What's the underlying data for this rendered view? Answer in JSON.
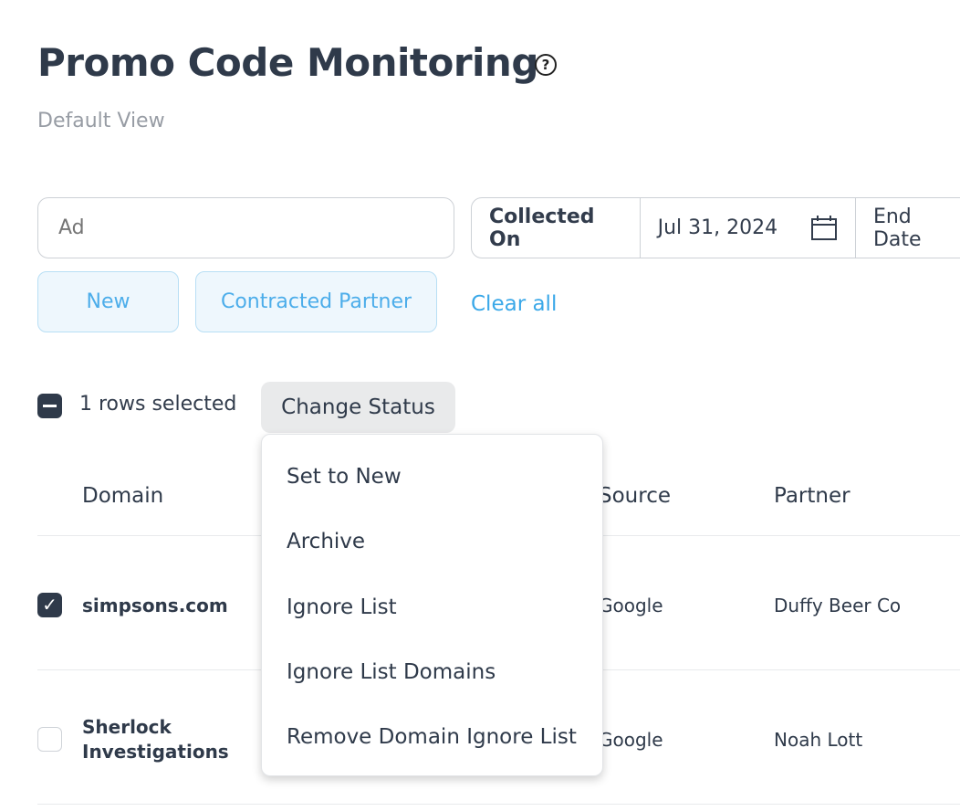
{
  "header": {
    "title": "Promo Code Monitoring",
    "help_icon": "?",
    "subtitle": "Default View"
  },
  "filters": {
    "search_placeholder": "Ad",
    "date_label": "Collected On",
    "start_date": "Jul 31, 2024",
    "end_date_placeholder": "End Date",
    "chips": [
      "New",
      "Contracted Partner"
    ],
    "clear_all": "Clear all"
  },
  "selection": {
    "text": "1 rows selected",
    "change_status": "Change Status"
  },
  "menu": {
    "items": [
      "Set to New",
      "Archive",
      "Ignore List",
      "Ignore List Domains",
      "Remove Domain Ignore List"
    ]
  },
  "table": {
    "columns": [
      "Domain",
      "Source",
      "Partner"
    ],
    "rows": [
      {
        "domain": "simpsons.com",
        "source": "Google",
        "partner": "Duffy Beer Co",
        "checked": true
      },
      {
        "domain": "Sherlock Investigations",
        "source": "Google",
        "partner": "Noah Lott",
        "checked": false
      }
    ]
  }
}
